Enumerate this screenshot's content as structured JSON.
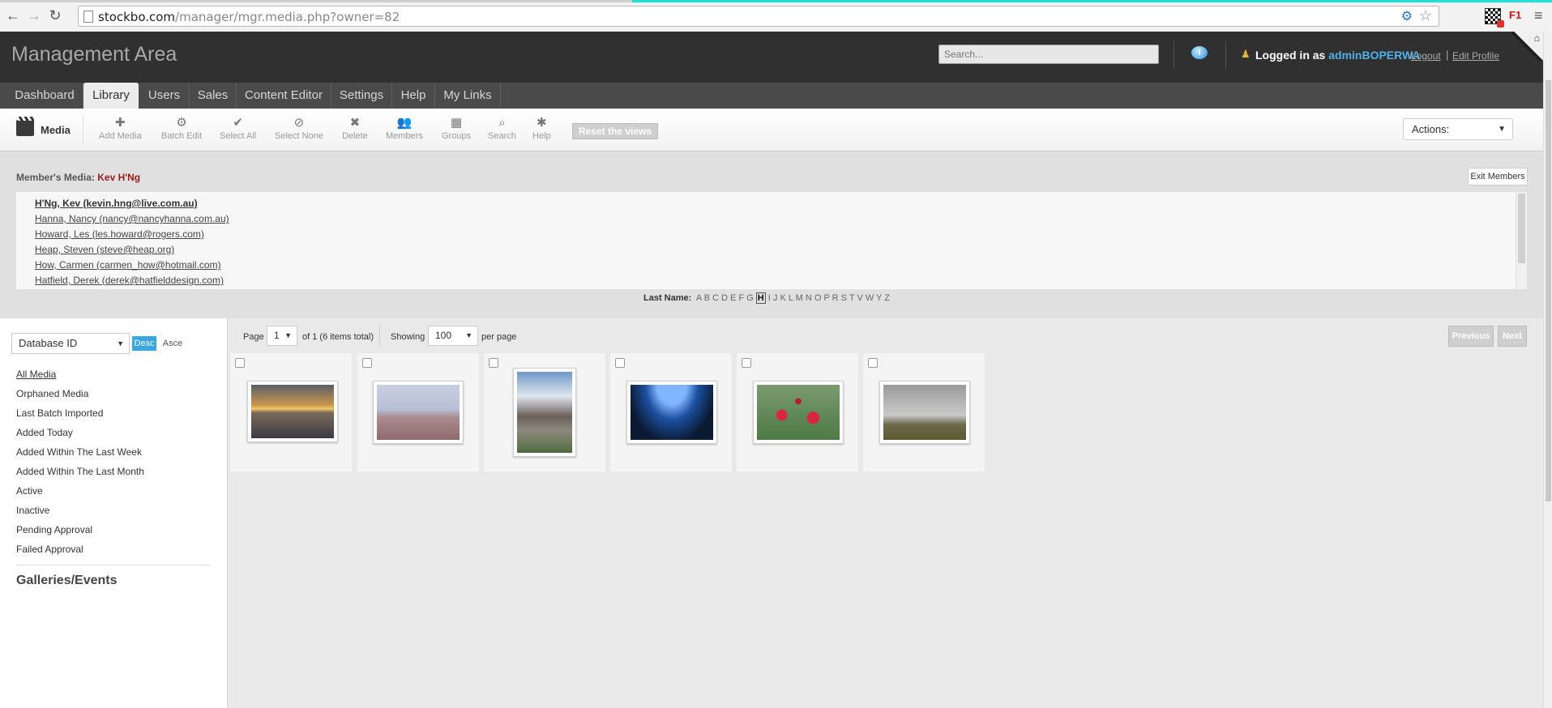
{
  "browser": {
    "url_host": "stockbo.com",
    "url_path": "/manager/mgr.media.php?owner=82",
    "ext_label": "F1"
  },
  "header": {
    "title": "Management Area",
    "search_placeholder": "Search...",
    "logged_in_prefix": "Logged in as",
    "username": "adminBOPERWA",
    "logout": "Logout",
    "separator": "|",
    "edit_profile": "Edit Profile"
  },
  "nav": {
    "tabs": [
      "Dashboard",
      "Library",
      "Users",
      "Sales",
      "Content Editor",
      "Settings",
      "Help",
      "My Links"
    ],
    "active": "Library"
  },
  "toolbar": {
    "section": "Media",
    "buttons": [
      "Add Media",
      "Batch Edit",
      "Select All",
      "Select None",
      "Delete",
      "Members",
      "Groups",
      "Search",
      "Help"
    ],
    "reset": "Reset the views",
    "actions": "Actions:"
  },
  "member": {
    "label": "Member's Media:",
    "name": "Kev H'Ng",
    "exit": "Exit Members",
    "list": [
      "H'Ng, Kev (kevin.hng@live.com.au)",
      "Hanna, Nancy (nancy@nancyhanna.com.au)",
      "Howard, Les (les.howard@rogers.com)",
      "Heap, Steven (steve@heap.org)",
      "How, Carmen (carmen_how@hotmail.com)",
      "Hatfield, Derek (derek@hatfielddesign.com)"
    ],
    "alpha_label": "Last Name:",
    "letters_before": "A B C D E F G",
    "current_letter": "H",
    "letters_after": "I J K L M N O P R S T V W Y Z"
  },
  "sidebar": {
    "sort_by": "Database ID",
    "desc": "Desc",
    "asce": "Asce",
    "filters": [
      "All Media",
      "Orphaned Media",
      "Last Batch Imported",
      "Added Today",
      "Added Within The Last Week",
      "Added Within The Last Month",
      "Active",
      "Inactive",
      "Pending Approval",
      "Failed Approval"
    ],
    "galleries": "Galleries/Events"
  },
  "pager": {
    "page_label": "Page",
    "page": "1",
    "of_total": "of 1 (6 items total)",
    "showing_label": "Showing",
    "per_page": "100",
    "per_page_label": "per page",
    "previous": "Previous",
    "next": "Next"
  },
  "thumbnails": [
    {
      "subject": "sunset over water"
    },
    {
      "subject": "bare trees and hills"
    },
    {
      "subject": "rock island coast"
    },
    {
      "subject": "skyscrapers looking up"
    },
    {
      "subject": "red flowers"
    },
    {
      "subject": "lighthouse on hill"
    }
  ]
}
